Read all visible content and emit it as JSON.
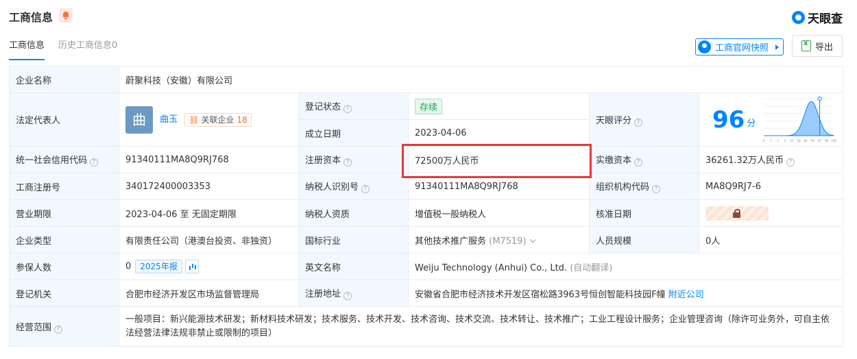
{
  "header": {
    "title": "工商信息",
    "logo_text": "天眼查"
  },
  "tabs": [
    {
      "label": "工商信息",
      "active": true
    },
    {
      "label": "历史工商信息0",
      "active": false
    }
  ],
  "actions": {
    "snapshot": "工商官网快照",
    "export": "导出"
  },
  "accent_color": "#0084ff",
  "highlight_color": "#e5383b",
  "rows": {
    "company_name": {
      "label": "企业名称",
      "value": "蔚聚科技（安徽）有限公司"
    },
    "legal_rep": {
      "label": "法定代表人",
      "avatar_char": "曲",
      "name": "曲玉",
      "related_label": "关联企业",
      "related_count": "18"
    },
    "reg_status": {
      "label": "登记状态",
      "value": "存续"
    },
    "found_date": {
      "label": "成立日期",
      "value": "2023-04-06"
    },
    "tianyan_score": {
      "label": "天眼评分",
      "value": "96",
      "unit": "分"
    },
    "credit_code": {
      "label": "统一社会信用代码",
      "value": "91340111MA8Q9RJ768"
    },
    "reg_capital": {
      "label": "注册资本",
      "value": "72500万人民币"
    },
    "paid_capital": {
      "label": "实缴资本",
      "value": "36261.32万人民币"
    },
    "biz_reg_no": {
      "label": "工商注册号",
      "value": "340172400003353"
    },
    "taxpayer_id": {
      "label": "纳税人识别号",
      "value": "91340111MA8Q9RJ768"
    },
    "org_code": {
      "label": "组织机构代码",
      "value": "MA8Q9RJ7-6"
    },
    "biz_term": {
      "label": "营业期限",
      "value": "2023-04-06 至 无固定期限"
    },
    "taxpayer_qual": {
      "label": "纳税人资质",
      "value": "增值税一般纳税人"
    },
    "approval_date": {
      "label": "核准日期"
    },
    "company_type": {
      "label": "企业类型",
      "value": "有限责任公司（港澳台投资、非独资）"
    },
    "industry": {
      "label": "国标行业",
      "value": "其他技术推广服务",
      "code": "(M7519)"
    },
    "staff_size": {
      "label": "人员规模",
      "value": "0人"
    },
    "insured": {
      "label": "参保人数",
      "value": "0",
      "year_tag": "2025年报"
    },
    "english_name": {
      "label": "英文名称",
      "value": "Weiju Technology (Anhui) Co., Ltd.",
      "note": "(自动翻译)"
    },
    "reg_authority": {
      "label": "登记机关",
      "value": "合肥市经济开发区市场监督管理局"
    },
    "reg_address": {
      "label": "注册地址",
      "value": "安徽省合肥市经济技术开发区宿松路3963号恒创智能科技园F幢",
      "nearby": "附近公司"
    },
    "biz_scope": {
      "label": "经营范围",
      "value": "一般项目：新兴能源技术研发；新材料技术研发；技术服务、技术开发、技术咨询、技术交流、技术转让、技术推广；工业工程设计服务；企业管理咨询（除许可业务外，可自主依法经营法律法规非禁止或限制的项目）"
    }
  },
  "chart_data": {
    "type": "area",
    "x": [
      0,
      10,
      20,
      30,
      40,
      50,
      60,
      70,
      80,
      90,
      100
    ],
    "tick_labels": [
      "0",
      "1",
      "3",
      "5",
      "15",
      "50",
      "85",
      "95",
      "97",
      "99",
      "100"
    ],
    "marker_x_tick": "97",
    "shape": "bell"
  }
}
